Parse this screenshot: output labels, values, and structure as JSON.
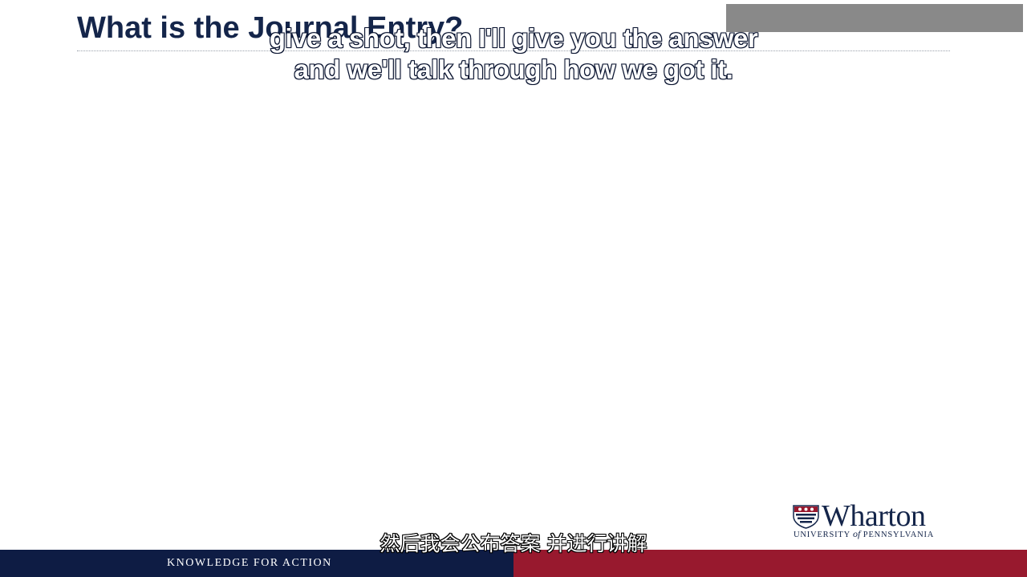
{
  "slide": {
    "title": "What is the Journal Entry?",
    "footer_tagline": "KNOWLEDGE FOR ACTION"
  },
  "logo": {
    "wordmark": "Wharton",
    "sub_prefix": "UNIVERSITY ",
    "sub_of": "of",
    "sub_suffix": " PENNSYLVANIA"
  },
  "subtitles": {
    "english_line1": "give a shot, then I'll give you the answer",
    "english_line2": "and we'll talk through how we got it.",
    "chinese": "然后我会公布答案 并进行讲解"
  },
  "colors": {
    "navy": "#14254a",
    "footer_navy": "#0e1c44",
    "footer_red": "#98192e",
    "overlay_gray": "#898989"
  }
}
